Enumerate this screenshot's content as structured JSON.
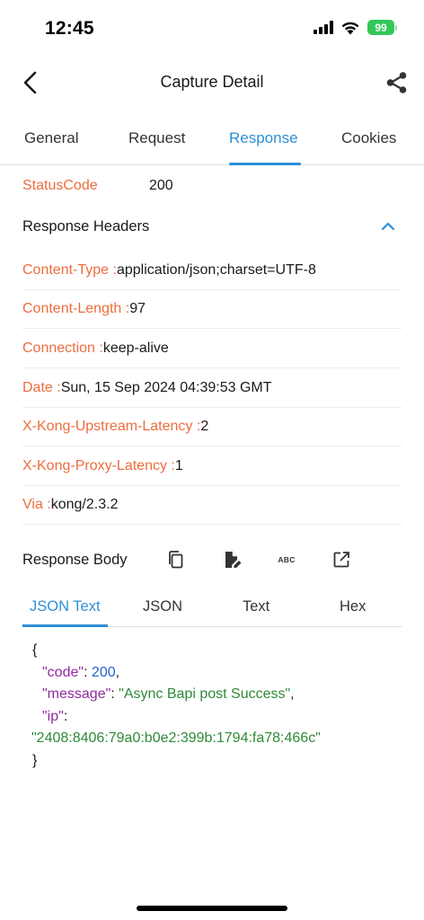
{
  "status_bar": {
    "time": "12:45",
    "battery": "99",
    "battery_color": "#34c759",
    "icons": [
      "cellular-signal-icon",
      "wifi-icon",
      "battery-charging-icon"
    ]
  },
  "nav": {
    "title": "Capture Detail",
    "back_icon": "chevron-left-icon",
    "share_icon": "share-icon"
  },
  "tabs": [
    {
      "label": "General",
      "active": false
    },
    {
      "label": "Request",
      "active": false
    },
    {
      "label": "Response",
      "active": true
    },
    {
      "label": "Cookies",
      "active": false
    }
  ],
  "status": {
    "key": "StatusCode",
    "value": "200"
  },
  "headers_section": {
    "title": "Response Headers",
    "toggle_icon": "chevron-up-icon"
  },
  "headers": [
    {
      "key": "Content-Type : ",
      "value": "application/json;charset=UTF-8"
    },
    {
      "key": "Content-Length : ",
      "value": "97"
    },
    {
      "key": "Connection : ",
      "value": "keep-alive"
    },
    {
      "key": "Date : ",
      "value": "Sun, 15 Sep 2024 04:39:53 GMT"
    },
    {
      "key": "X-Kong-Upstream-Latency : ",
      "value": "2"
    },
    {
      "key": "X-Kong-Proxy-Latency : ",
      "value": "1"
    },
    {
      "key": "Via : ",
      "value": "kong/2.3.2"
    }
  ],
  "body_section": {
    "title": "Response Body",
    "tools": [
      "copy-icon",
      "edit-document-icon",
      "abc-text-icon",
      "open-external-icon"
    ],
    "tool_abc_label": "ABC"
  },
  "body_tabs": [
    {
      "label": "JSON Text",
      "active": true
    },
    {
      "label": "JSON",
      "active": false
    },
    {
      "label": "Text",
      "active": false
    },
    {
      "label": "Hex",
      "active": false
    }
  ],
  "json": {
    "open": "{",
    "close": "}",
    "code_key": "\"code\"",
    "code_val": "200",
    "message_key": "\"message\"",
    "message_val": "\"Async Bapi post Success\"",
    "ip_key": "\"ip\"",
    "ip_val": "\"2408:8406:79a0:b0e2:399b:1794:fa78:466c\"",
    "colon": ": ",
    "comma": ","
  },
  "colors": {
    "accent": "#2e8fd6",
    "key": "#ec6d3d",
    "json_key": "#8e2a9e",
    "json_number": "#2563c9",
    "json_string": "#2e8a36"
  }
}
